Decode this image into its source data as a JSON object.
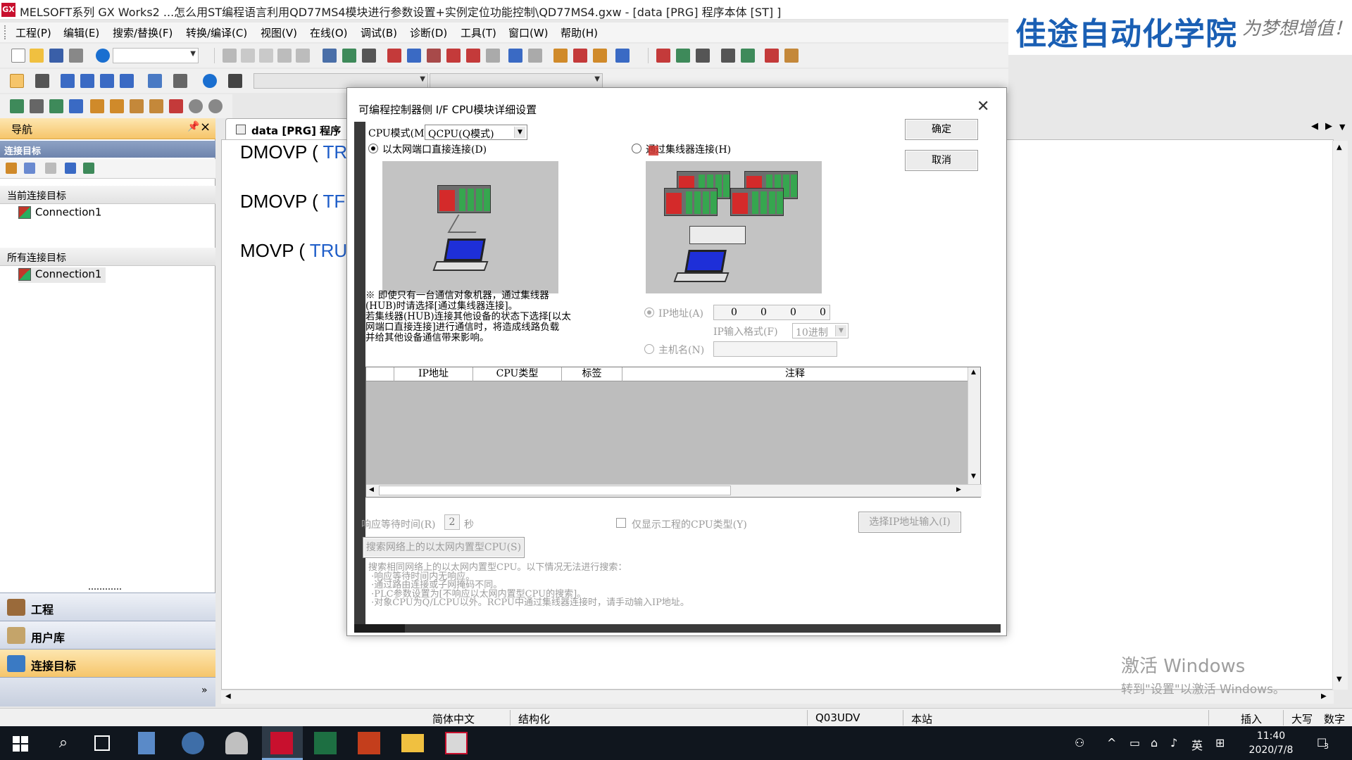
{
  "window": {
    "title": "MELSOFT系列 GX Works2 ...怎么用ST编程语言利用QD77MS4模块进行参数设置+实例定位功能控制\\QD77MS4.gxw - [data [PRG] 程序本体 [ST] ]",
    "icon_text": "GX"
  },
  "logo": {
    "main": "佳途自动化学院",
    "slogan": "为梦想增值！"
  },
  "menu": [
    "工程(P)",
    "编辑(E)",
    "搜索/替换(F)",
    "转换/编译(C)",
    "视图(V)",
    "在线(O)",
    "调试(B)",
    "诊断(D)",
    "工具(T)",
    "窗口(W)",
    "帮助(H)"
  ],
  "nav": {
    "title": "导航",
    "section_label": "连接目标",
    "current_header": "当前连接目标",
    "current_item": "Connection1",
    "all_header": "所有连接目标",
    "all_item": "Connection1",
    "buttons": [
      "工程",
      "用户库",
      "连接目标"
    ]
  },
  "editor": {
    "tab_label": "data [PRG] 程序",
    "lines": [
      {
        "kw": "DMOVP ( ",
        "val": "TR"
      },
      {
        "kw": "DMOVP ( ",
        "val": "TF"
      },
      {
        "kw": "MOVP ( ",
        "val": "TRU"
      }
    ]
  },
  "dialog": {
    "title": "可编程控制器侧 I/F CPU模块详细设置",
    "ok_label": "确定",
    "cancel_label": "取消",
    "cpu_mode_label": "CPU模式(M)",
    "cpu_mode_value": "QCPU(Q模式)",
    "direct_label": "以太网端口直接连接(D)",
    "hub_label": "通过集线器连接(H)",
    "note": "※ 即使只有一台通信对象机器，通过集线器\n(HUB)时请选择[通过集线器连接]。\n若集线器(HUB)连接其他设备的状态下选择[以太\n网端口直接连接]进行通信时，将造成线路负载\n并给其他设备通信带来影响。",
    "ip_label": "IP地址(A)",
    "ip_octets": [
      "0",
      "0",
      "0",
      "0"
    ],
    "ip_format_label": "IP输入格式(F)",
    "ip_format_value": "10进制",
    "host_label": "主机名(N)",
    "table_headers": [
      "IP地址",
      "CPU类型",
      "标签",
      "注释"
    ],
    "wait_label": "响应等待时间(R)",
    "wait_value": "2",
    "wait_unit": "秒",
    "only_cpu_label": "仅显示工程的CPU类型(Y)",
    "select_ip_button": "选择IP地址输入(I)",
    "search_button": "搜索网络上的以太网内置型CPU(S)",
    "search_note": "搜索相同网络上的以太网内置型CPU。以下情况无法进行搜索：\n ·响应等待时间内无响应。\n ·通过路由连接或子网掩码不同。\n ·PLC参数设置为[不响应以太网内置型CPU的搜索]。\n ·对象CPU为Q/LCPU以外。RCPU中通过集线器连接时，请手动输入IP地址。"
  },
  "watermark": {
    "line1": "激活 Windows",
    "line2": "转到\"设置\"以激活 Windows。"
  },
  "status": {
    "lang": "简体中文",
    "mode": "结构化",
    "cpu": "Q03UDV",
    "station": "本站",
    "insert": "插入",
    "caps": "大写",
    "num": "数字"
  },
  "taskbar": {
    "ime_lang": "英",
    "time": "11:40",
    "date": "2020/7/8",
    "notif_count": "3"
  },
  "colors": {
    "nav_accent": "#f6c56a",
    "code_value": "#1f5ec9",
    "logo_blue": "#1a5fb4"
  }
}
